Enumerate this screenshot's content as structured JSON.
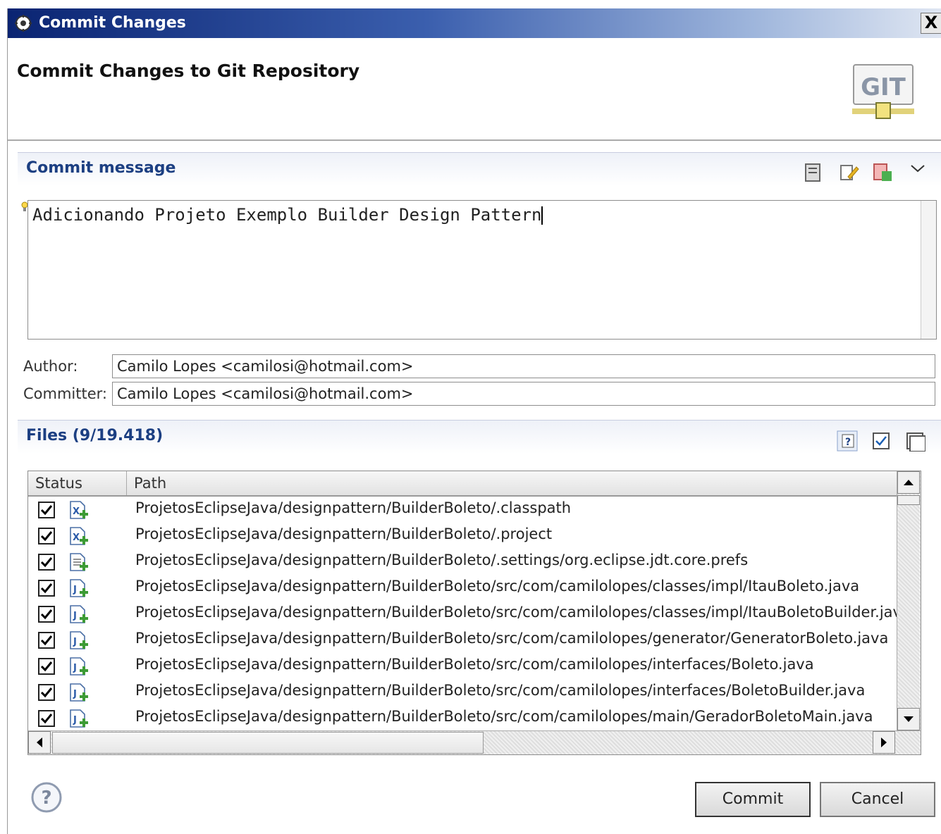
{
  "window": {
    "title": "Commit Changes",
    "close_label": "X"
  },
  "header": {
    "title": "Commit Changes to Git Repository",
    "logo_text": "GIT"
  },
  "commit_message": {
    "section_title": "Commit message",
    "text": "Adicionando Projeto Exemplo Builder Design Pattern"
  },
  "author": {
    "label": "Author:",
    "value": "Camilo Lopes <camilosi@hotmail.com>"
  },
  "committer": {
    "label": "Committer:",
    "value": "Camilo Lopes <camilosi@hotmail.com>"
  },
  "files": {
    "section_title": "Files (9/19.418)",
    "columns": {
      "status": "Status",
      "path": "Path"
    },
    "rows": [
      {
        "path": "ProjetosEclipseJava/designpattern/BuilderBoleto/.classpath",
        "checked": true,
        "icon": "xml-file-added-icon"
      },
      {
        "path": "ProjetosEclipseJava/designpattern/BuilderBoleto/.project",
        "checked": true,
        "icon": "xml-file-added-icon"
      },
      {
        "path": "ProjetosEclipseJava/designpattern/BuilderBoleto/.settings/org.eclipse.jdt.core.prefs",
        "checked": true,
        "icon": "text-file-added-icon"
      },
      {
        "path": "ProjetosEclipseJava/designpattern/BuilderBoleto/src/com/camilolopes/classes/impl/ItauBoleto.java",
        "checked": true,
        "icon": "java-file-added-icon"
      },
      {
        "path": "ProjetosEclipseJava/designpattern/BuilderBoleto/src/com/camilolopes/classes/impl/ItauBoletoBuilder.jav",
        "checked": true,
        "icon": "java-file-added-icon"
      },
      {
        "path": "ProjetosEclipseJava/designpattern/BuilderBoleto/src/com/camilolopes/generator/GeneratorBoleto.java",
        "checked": true,
        "icon": "java-file-added-icon"
      },
      {
        "path": "ProjetosEclipseJava/designpattern/BuilderBoleto/src/com/camilolopes/interfaces/Boleto.java",
        "checked": true,
        "icon": "java-file-added-icon"
      },
      {
        "path": "ProjetosEclipseJava/designpattern/BuilderBoleto/src/com/camilolopes/interfaces/BoletoBuilder.java",
        "checked": true,
        "icon": "java-file-added-icon"
      },
      {
        "path": "ProjetosEclipseJava/designpattern/BuilderBoleto/src/com/camilolopes/main/GeradorBoletoMain.java",
        "checked": true,
        "icon": "java-file-added-icon"
      }
    ]
  },
  "buttons": {
    "commit": "Commit",
    "cancel": "Cancel"
  },
  "colors": {
    "section_title": "#1c3f82",
    "titlebar_start": "#0a2472"
  }
}
